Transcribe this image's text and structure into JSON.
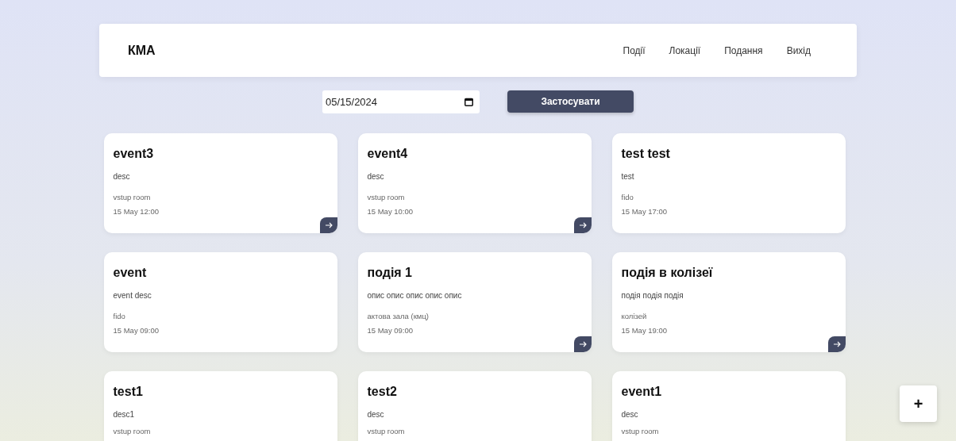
{
  "header": {
    "logo": "КМА",
    "nav": [
      "Події",
      "Локації",
      "Подання",
      "Вихід"
    ]
  },
  "filter": {
    "date": "05/15/2024",
    "button": "Застосувати"
  },
  "events": [
    {
      "title": "event3",
      "description": "desc",
      "location": "vstup room",
      "time": "15 May 12:00",
      "has_action": true
    },
    {
      "title": "event4",
      "description": "desc",
      "location": "vstup room",
      "time": "15 May 10:00",
      "has_action": true
    },
    {
      "title": "test test",
      "description": "test",
      "location": "fido",
      "time": "15 May 17:00",
      "has_action": false
    },
    {
      "title": "event",
      "description": "event desc",
      "location": "fido",
      "time": "15 May 09:00",
      "has_action": false
    },
    {
      "title": "подія 1",
      "description": "опис опис опис опис опис",
      "location": "актова зала (кмц)",
      "time": "15 May 09:00",
      "has_action": true
    },
    {
      "title": "подія в колізеї",
      "description": "подія подія подія",
      "location": "колізей",
      "time": "15 May 19:00",
      "has_action": true
    },
    {
      "title": "test1",
      "description": "desc1",
      "location": "vstup room"
    },
    {
      "title": "test2",
      "description": "desc",
      "location": "vstup room"
    },
    {
      "title": "event1",
      "description": "desc",
      "location": "vstup room"
    }
  ],
  "add_button": "+"
}
